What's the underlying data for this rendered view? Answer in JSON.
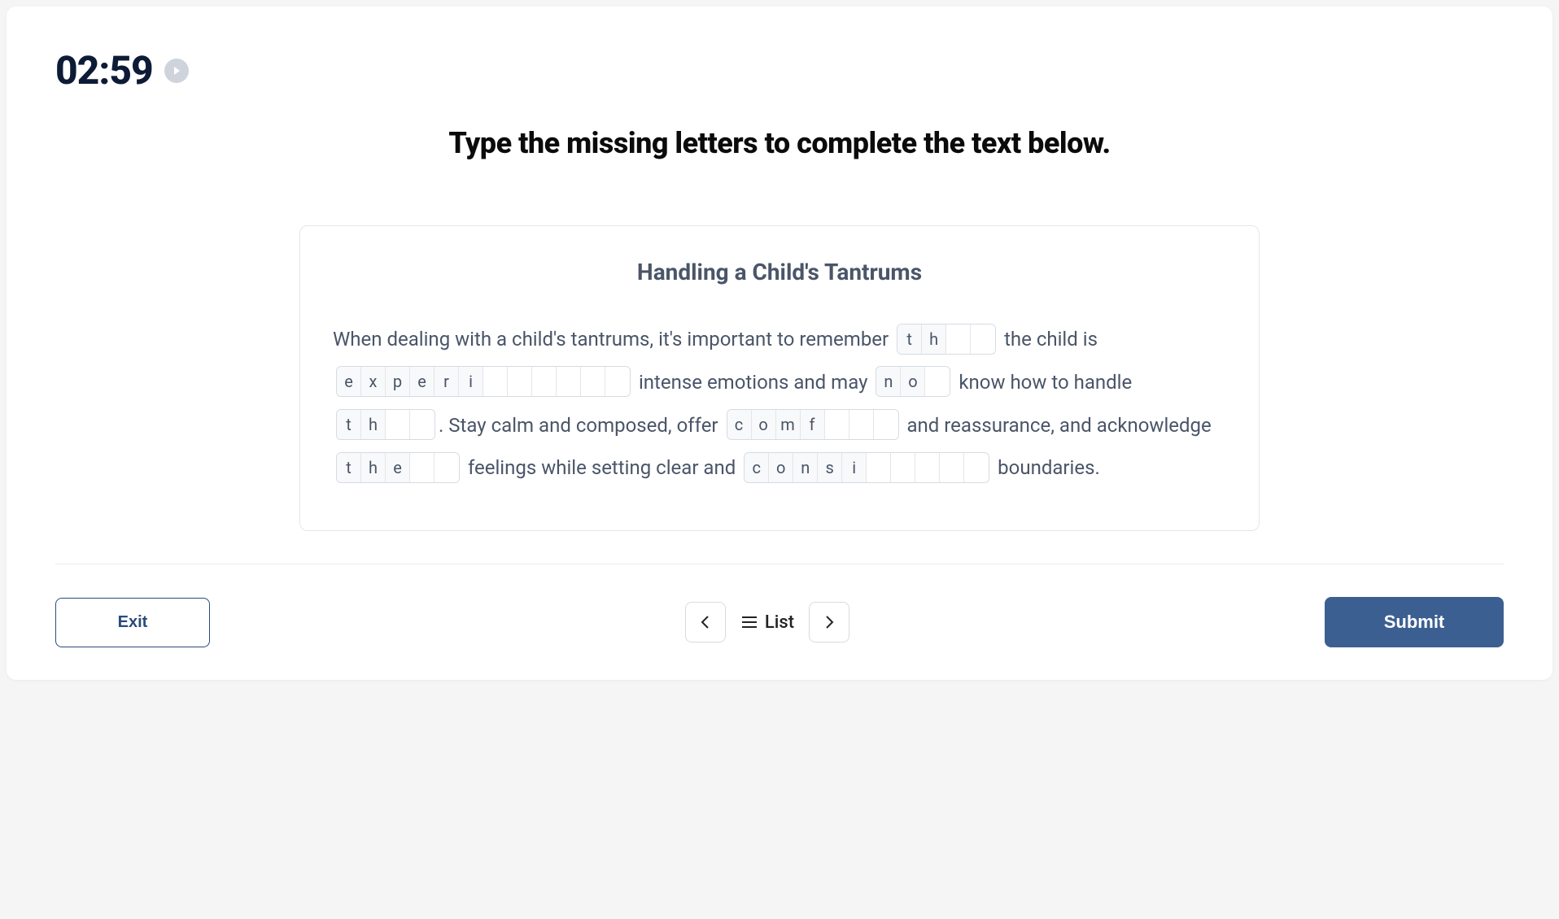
{
  "timer": "02:59",
  "instruction": "Type the missing letters to complete the text below.",
  "exercise": {
    "title": "Handling a Child's Tantrums",
    "segments": [
      {
        "kind": "text",
        "value": "When dealing with a child's tantrums, it's important to remember "
      },
      {
        "kind": "word",
        "prefilled": [
          "t",
          "h"
        ],
        "blanks": 2
      },
      {
        "kind": "text",
        "value": " the child is "
      },
      {
        "kind": "word",
        "prefilled": [
          "e",
          "x",
          "p",
          "e",
          "r",
          "i"
        ],
        "blanks": 6
      },
      {
        "kind": "text",
        "value": " intense emotions and may "
      },
      {
        "kind": "word",
        "prefilled": [
          "n",
          "o"
        ],
        "blanks": 1
      },
      {
        "kind": "text",
        "value": " know how to handle "
      },
      {
        "kind": "word",
        "prefilled": [
          "t",
          "h"
        ],
        "blanks": 2
      },
      {
        "kind": "text",
        "value": ".  Stay calm and composed, offer "
      },
      {
        "kind": "word",
        "prefilled": [
          "c",
          "o",
          "m",
          "f"
        ],
        "blanks": 3
      },
      {
        "kind": "text",
        "value": " and reassurance, and acknowledge "
      },
      {
        "kind": "word",
        "prefilled": [
          "t",
          "h",
          "e"
        ],
        "blanks": 2
      },
      {
        "kind": "text",
        "value": " feelings while setting clear and "
      },
      {
        "kind": "word",
        "prefilled": [
          "c",
          "o",
          "n",
          "s",
          "i"
        ],
        "blanks": 5
      },
      {
        "kind": "text",
        "value": " boundaries."
      }
    ]
  },
  "footer": {
    "exit": "Exit",
    "list": "List",
    "submit": "Submit"
  }
}
